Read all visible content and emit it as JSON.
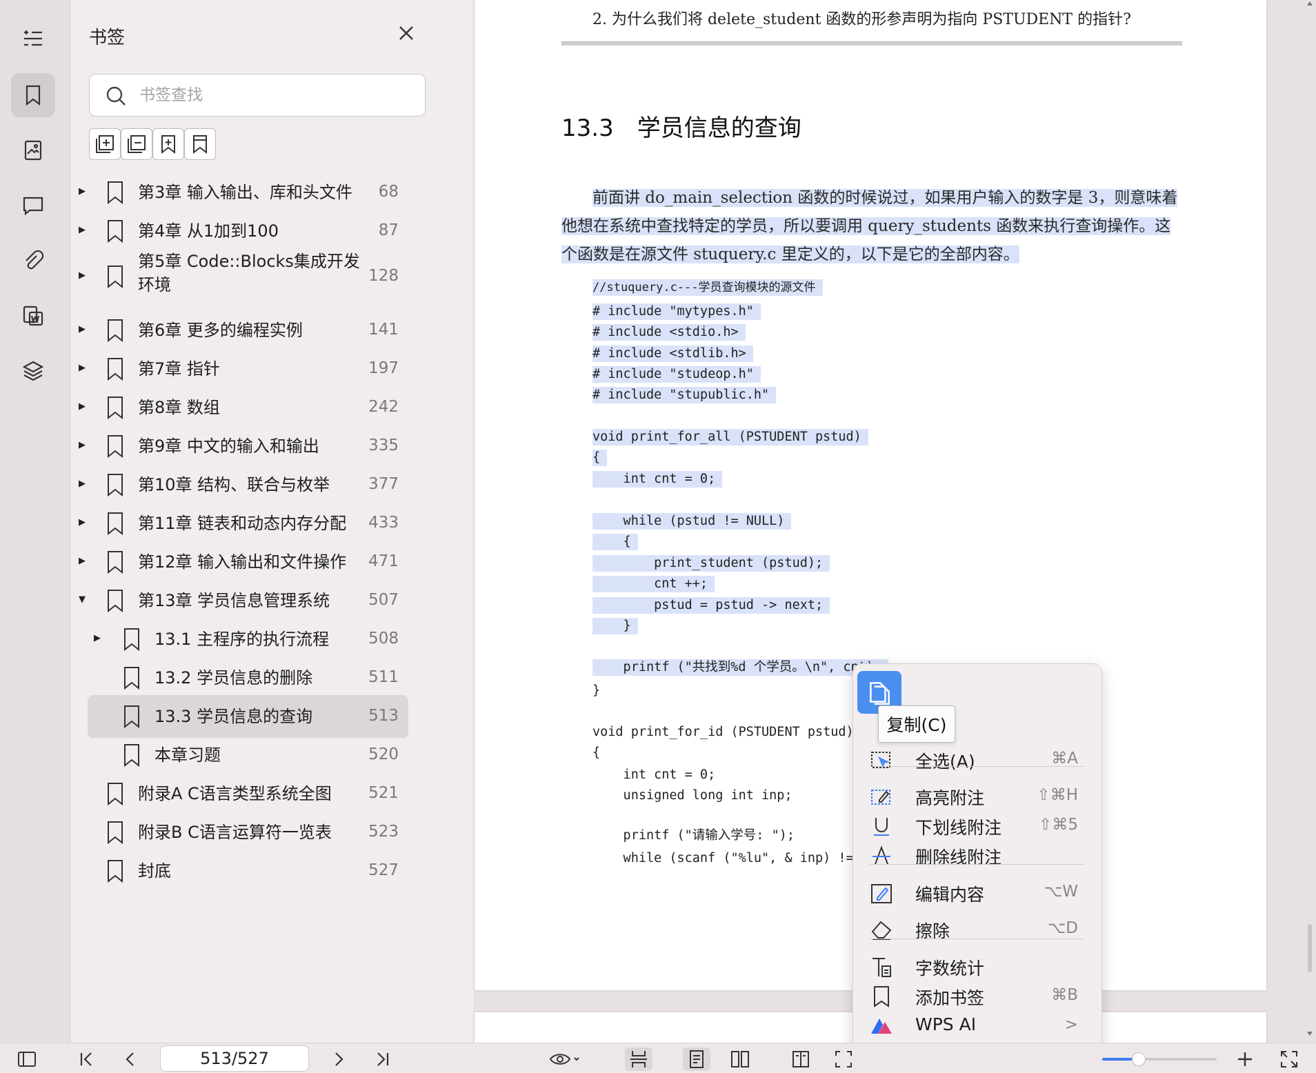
{
  "panel": {
    "title": "书签",
    "search_placeholder": "书签查找"
  },
  "bookmarks": [
    {
      "label": "第3章 输入输出、库和头文件",
      "page": "68"
    },
    {
      "label": "第4章 从1加到100",
      "page": "87"
    },
    {
      "label": "第5章 Code::Blocks集成开发",
      "label2": "环境",
      "page": "128"
    },
    {
      "label": "第6章 更多的编程实例",
      "page": "141"
    },
    {
      "label": "第7章 指针",
      "page": "197"
    },
    {
      "label": "第8章 数组",
      "page": "242"
    },
    {
      "label": "第9章 中文的输入和输出",
      "page": "335"
    },
    {
      "label": "第10章 结构、联合与枚举",
      "page": "377"
    },
    {
      "label": "第11章 链表和动态内存分配",
      "page": "433"
    },
    {
      "label": "第12章 输入输出和文件操作",
      "page": "471"
    },
    {
      "label": "第13章 学员信息管理系统",
      "page": "507"
    },
    {
      "label": "13.1 主程序的执行流程",
      "page": "508"
    },
    {
      "label": "13.2 学员信息的删除",
      "page": "511"
    },
    {
      "label": "13.3 学员信息的查询",
      "page": "513"
    },
    {
      "label": "本章习题",
      "page": "520"
    },
    {
      "label": "附录A C语言类型系统全图",
      "page": "521"
    },
    {
      "label": "附录B C语言运算符一览表",
      "page": "523"
    },
    {
      "label": "封底",
      "page": "527"
    }
  ],
  "document": {
    "question": "2. 为什么我们将 delete_student 函数的形参声明为指向 PSTUDENT 的指针?",
    "section": "13.3　学员信息的查询",
    "para_line1": "前面讲 do_main_selection 函数的时候说过，如果用户输入的数字是 3，则意味着",
    "para_line2": "他想在系统中查找特定的学员，所以要调用 query_students 函数来执行查询操作。这",
    "para_line3": "个函数是在源文件 stuquery.c 里定义的，以下是它的全部内容。",
    "code": [
      "//stuquery.c---学员查询模块的源文件",
      "# include \"mytypes.h\"",
      "# include <stdio.h>",
      "# include <stdlib.h>",
      "# include \"studeop.h\"",
      "# include \"stupublic.h\"",
      "void print_for_all (PSTUDENT pstud)",
      "{",
      "    int cnt = 0;",
      "    while (pstud != NULL)",
      "    {",
      "        print_student (pstud);",
      "        cnt ++;",
      "        pstud = pstud -> next;",
      "    }",
      "    printf (\"共找到%d 个学员。\\n\", cnt);",
      "}",
      "void print_for_id (PSTUDENT pstud)",
      "{",
      "    int cnt = 0;",
      "    unsigned long int inp;",
      "    printf (\"请输入学号: \");",
      "    while (scanf (\"%lu\", & inp) != "
    ]
  },
  "context_menu": {
    "copy_tooltip": "复制(C)",
    "items": [
      {
        "label": "全选(A)",
        "shortcut": "⌘A"
      },
      {
        "label": "高亮附注",
        "shortcut": "⇧⌘H"
      },
      {
        "label": "下划线附注",
        "shortcut": "⇧⌘5"
      },
      {
        "label": "删除线附注",
        "shortcut": ""
      },
      {
        "label": "编辑内容",
        "shortcut": "⌥W"
      },
      {
        "label": "擦除",
        "shortcut": "⌥D"
      },
      {
        "label": "字数统计",
        "shortcut": ""
      },
      {
        "label": "添加书签",
        "shortcut": "⌘B"
      },
      {
        "label": "WPS AI",
        "shortcut": ">"
      }
    ]
  },
  "statusbar": {
    "page_indicator": "513/527",
    "zoom_fraction": 0.32
  },
  "colors": {
    "selection_highlight": "#d9e2f8",
    "accent": "#4a8ff0"
  }
}
